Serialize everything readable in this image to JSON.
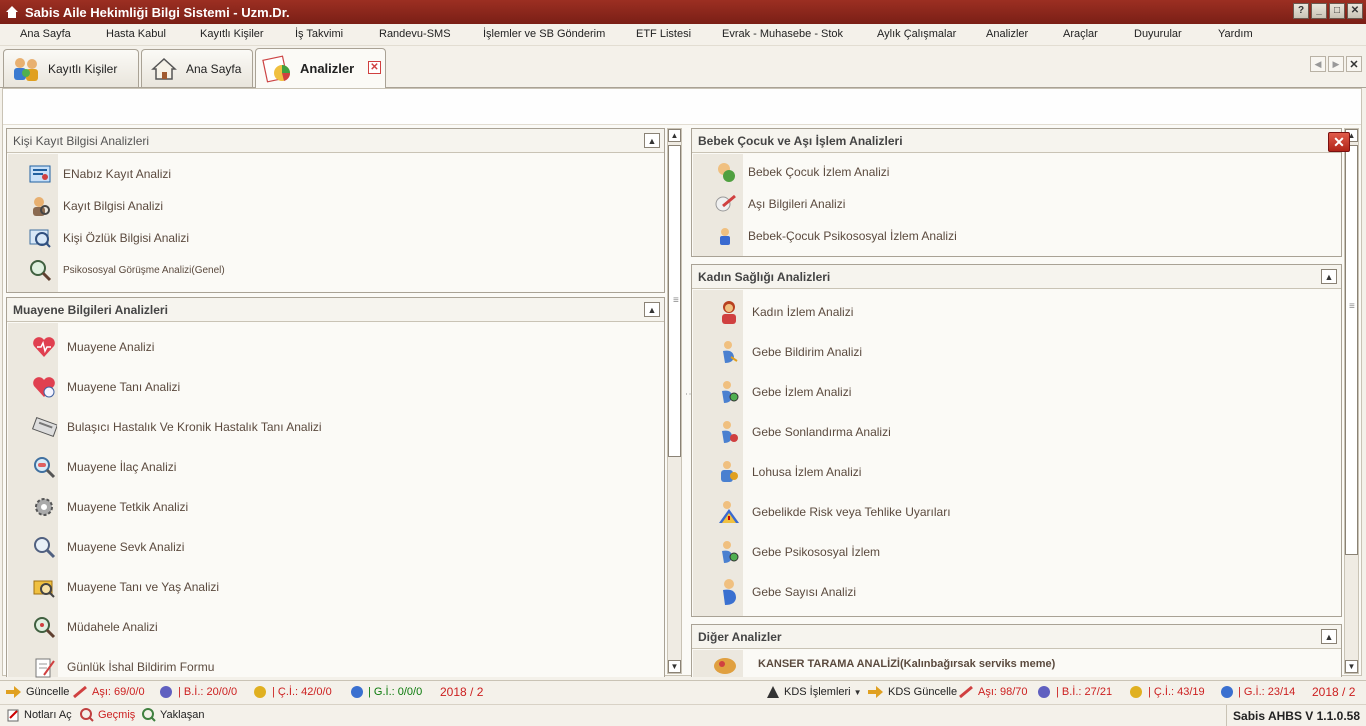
{
  "titlebar": {
    "title": "Sabis Aile Hekimliği Bilgi Sistemi  -  Uzm.Dr."
  },
  "window_buttons": {
    "help": "?",
    "minimize": "_",
    "maximize": "□",
    "close": "✕"
  },
  "menu": [
    "Ana Sayfa",
    "Hasta Kabul",
    "Kayıtlı Kişiler",
    "İş Takvimi",
    "Randevu-SMS",
    "İşlemler ve SB Gönderim",
    "ETF Listesi",
    "Evrak - Muhasebe - Stok",
    "Aylık Çalışmalar",
    "Analizler",
    "Araçlar",
    "Duyurular",
    "Yardım"
  ],
  "tabs": [
    {
      "label": "Kayıtlı Kişiler",
      "icon": "people-icon"
    },
    {
      "label": "Ana Sayfa",
      "icon": "home-icon"
    },
    {
      "label": "Analizler",
      "icon": "chart-icon"
    }
  ],
  "groups": {
    "kisi": {
      "title": "Kişi Kayıt Bilgisi Analizleri",
      "items": [
        "ENabız Kayıt Analizi",
        "Kayıt Bilgisi Analizi",
        "Kişi Özlük Bilgisi Analizi",
        "Psikososyal Görüşme Analizi(Genel)"
      ]
    },
    "muayene": {
      "title": "Muayene Bilgileri Analizleri",
      "items": [
        "Muayene Analizi",
        "Muayene Tanı Analizi",
        "Bulaşıcı Hastalık Ve Kronik Hastalık Tanı Analizi",
        "Muayene İlaç Analizi",
        "Muayene Tetkik Analizi",
        "Muayene Sevk Analizi",
        "Muayene Tanı ve Yaş Analizi",
        "Müdahele Analizi",
        "Günlük İshal Bildirim Formu"
      ]
    },
    "bebek": {
      "title": "Bebek Çocuk ve Aşı İşlem Analizleri",
      "items": [
        "Bebek Çocuk İzlem Analizi",
        "Aşı Bilgileri Analizi",
        "Bebek-Çocuk Psikososyal İzlem Analizi"
      ]
    },
    "kadin": {
      "title": "Kadın Sağlığı Analizleri",
      "items": [
        "Kadın İzlem Analizi",
        "Gebe Bildirim Analizi",
        "Gebe İzlem Analizi",
        "Gebe Sonlandırma Analizi",
        "Lohusa İzlem Analizi",
        "Gebelikde Risk veya Tehlike Uyarıları",
        "Gebe Psikososyal İzlem",
        "Gebe Sayısı Analizi"
      ]
    },
    "diger": {
      "title": "Diğer Analizler",
      "items": [
        "KANSER TARAMA ANALİZİ(Kalınbağırsak serviks meme)"
      ]
    }
  },
  "status_left": {
    "guncelle": "Güncelle",
    "asi": "Aşı: 69/0/0",
    "bi": "| B.İ.: 20/0/0",
    "ci": "| Ç.İ.: 42/0/0",
    "gi": "| G.İ.: 0/0/0",
    "period": "2018 / 2"
  },
  "status_right": {
    "kds_islemleri": "KDS İşlemleri",
    "kds_guncelle": "KDS Güncelle",
    "asi": "Aşı: 98/70",
    "bi": "| B.İ.: 27/21",
    "ci": "| Ç.İ.: 43/19",
    "gi": "| G.İ.: 23/14",
    "period": "2018 / 2"
  },
  "status_bottom": {
    "notes": "Notları Aç",
    "past": "Geçmiş",
    "near": "Yaklaşan",
    "version": "Sabis AHBS V 1.1.0.58"
  }
}
